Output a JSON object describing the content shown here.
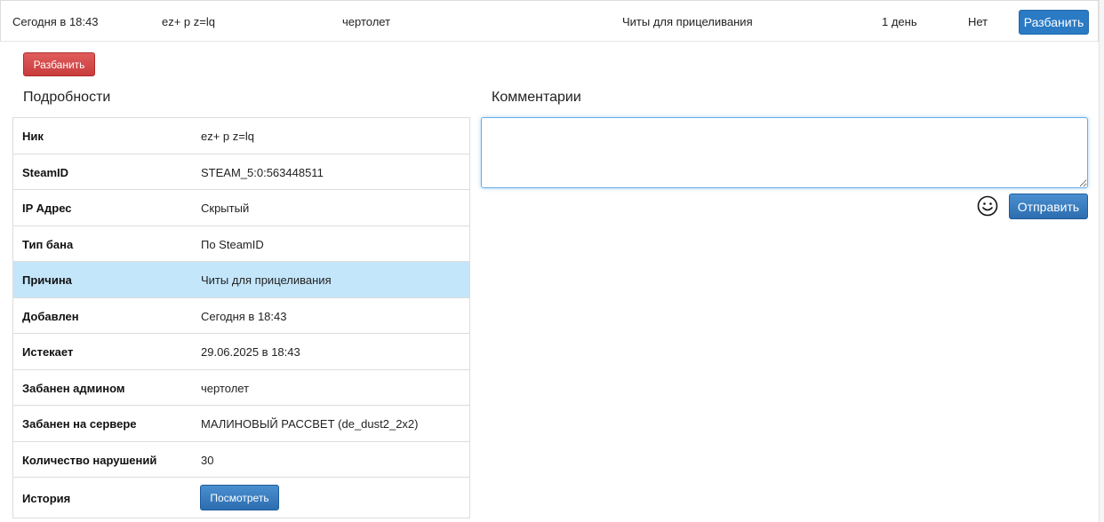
{
  "ban_row": {
    "date": "Сегодня в 18:43",
    "nick": "ez+ p z=lq",
    "admin": "чертолет",
    "reason": "Читы для прицеливания",
    "length": "1 день",
    "expired": "Нет",
    "unban_label": "Разбанить"
  },
  "actions": {
    "unban_label": "Разбанить"
  },
  "details": {
    "title": "Подробности",
    "rows": [
      {
        "key": "Ник",
        "value": "ez+ p z=lq"
      },
      {
        "key": "SteamID",
        "value": "STEAM_5:0:563448511"
      },
      {
        "key": "IP Адрес",
        "value": "Скрытый"
      },
      {
        "key": "Тип бана",
        "value": "По SteamID"
      },
      {
        "key": "Причина",
        "value": "Читы для прицеливания"
      },
      {
        "key": "Добавлен",
        "value": "Сегодня в 18:43"
      },
      {
        "key": "Истекает",
        "value": "29.06.2025 в 18:43"
      },
      {
        "key": "Забанен админом",
        "value": "чертолет"
      },
      {
        "key": "Забанен на сервере",
        "value": "МАЛИНОВЫЙ РАССВЕТ (de_dust2_2x2)"
      },
      {
        "key": "Количество нарушений",
        "value": "30"
      }
    ],
    "history": {
      "key": "История",
      "button_label": "Посмотреть"
    }
  },
  "comments": {
    "title": "Комментарии",
    "value": "",
    "send_label": "Отправить",
    "emoji_icon": "smiley-icon"
  },
  "colors": {
    "primary": "#2a7ac4",
    "danger": "#d34848",
    "highlight_row": "#c4e6fb",
    "focus_border": "#66afe9"
  }
}
